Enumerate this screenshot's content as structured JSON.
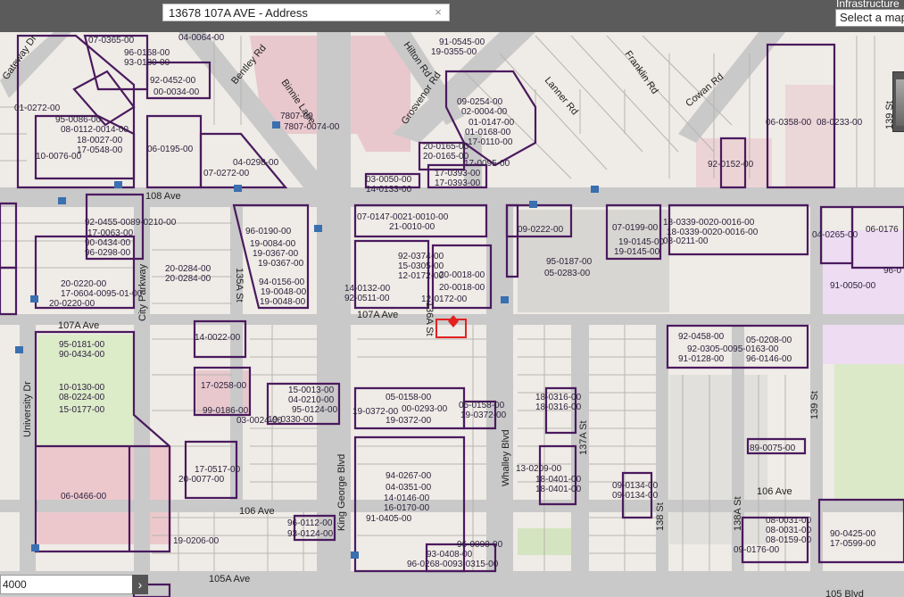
{
  "search": {
    "value": "13678 107A AVE - Address",
    "clear_glyph": "×"
  },
  "layer_panel": {
    "title": "Infrastructure",
    "select_label": "Select a map"
  },
  "scale_input": {
    "value": "4000",
    "go_glyph": "›"
  },
  "selected_parcel_color": "#e32222",
  "parcel_outline_color": "#4a1a5e",
  "streets": [
    "Gateway Dr",
    "Bentley Rd",
    "Binnie Lane",
    "Hilton Rd",
    "Grosvenor Rd",
    "Lanner Rd",
    "Franklin Rd",
    "Cowan Rd",
    "139 St",
    "108 Ave",
    "City Parkway",
    "135A St",
    "107A Ave",
    "107A Ave",
    "136A St",
    "University Dr",
    "King George Blvd",
    "Whalley Blvd",
    "137A St",
    "138 St",
    "138A St",
    "139 St",
    "106 Ave",
    "106 Ave",
    "105A Ave",
    "105 Blvd"
  ],
  "parcels": [
    "04-0064-00",
    "91-0545-00",
    "19-0355-00",
    "07-0365-00",
    "96-0168-00",
    "93-0180-00",
    "92-0452-00",
    "00-0034-00",
    "01-0272-00",
    "95-0086-00",
    "08-0112-0014-00",
    "18-0027-00",
    "17-0548-00",
    "06-0195-00",
    "10-0076-00",
    "7807-00",
    "7807-0074-00",
    "04-0298-00",
    "07-0272-00",
    "09-0254-00",
    "02-0004-00",
    "01-0147-00",
    "01-0168-00",
    "17-0110-00",
    "20-0165-00",
    "20-0165-00",
    "17-0095-00",
    "17-0393-00",
    "17-0393-00",
    "03-0050-00",
    "14-0133-00",
    "06-0358-00",
    "08-0233-00",
    "92-0152-00",
    "92-0455-0089-0210-00",
    "17-0063-00",
    "90-0434-00",
    "96-0298-00",
    "96-0190-00",
    "19-0084-00",
    "19-0367-00",
    "19-0367-00",
    "20-0284-00",
    "20-0284-00",
    "20-0220-00",
    "17-0604-0095-01-00",
    "20-0220-00",
    "07-0147-0021-0010-00",
    "21-0010-00",
    "09-0222-00",
    "07-0199-00",
    "19-0145-00",
    "19-0145-00",
    "18-0339-0020-0016-00",
    "18-0339-0020-0016-00",
    "08-0211-00",
    "04-0265-00",
    "06-0176",
    "96-0",
    "91-0050-00",
    "92-0374-00",
    "15-0305-00",
    "12-0172-00",
    "20-0018-00",
    "20-0018-00",
    "12-0172-00",
    "95-0187-00",
    "05-0283-00",
    "94-0156-00",
    "19-0048-00",
    "19-0048-00",
    "14-0132-00",
    "92-0511-00",
    "14-0022-00",
    "95-0181-00",
    "90-0434-00",
    "10-0130-00",
    "08-0224-00",
    "15-0177-00",
    "17-0258-00",
    "99-0186-00",
    "03-0024-00",
    "15-0013-00",
    "04-0210-00",
    "95-0124-00",
    "19-0330-00",
    "05-0158-00",
    "19-0372-00",
    "00-0293-00",
    "19-0372-00",
    "05-0158-00",
    "19-0372-00",
    "18-0316-00",
    "18-0316-00",
    "92-0458-00",
    "92-0305-0095-0163-00",
    "05-0208-00",
    "91-0128-00",
    "96-0146-00",
    "89-0075-00",
    "17-0517-00",
    "20-0077-00",
    "06-0466-00",
    "94-0267-00",
    "04-0351-00",
    "14-0146-00",
    "16-0170-00",
    "91-0405-00",
    "13-0209-00",
    "18-0401-00",
    "18-0401-00",
    "09-0134-00",
    "09-0134-00",
    "08-0031-00",
    "08-0031-00",
    "08-0159-00",
    "09-0176-00",
    "90-0425-00",
    "17-0599-00",
    "96-0112-00",
    "93-0124-00",
    "19-0206-00",
    "93-0408-00",
    "96-0268-0093-0315-00",
    "96-0090-00"
  ]
}
